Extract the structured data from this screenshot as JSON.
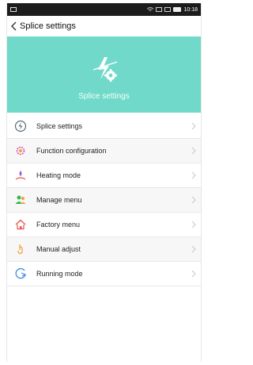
{
  "status_bar": {
    "time": "10:18"
  },
  "header": {
    "title": "Splice settings"
  },
  "banner": {
    "label": "Splice settings"
  },
  "menu": [
    {
      "label": "Splice settings",
      "icon": "splice-bolt-icon",
      "color": "#5b6b7a"
    },
    {
      "label": "Function configuration",
      "icon": "gear-config-icon",
      "color": "#d94fb1"
    },
    {
      "label": "Heating mode",
      "icon": "heating-icon",
      "color": "#9b5bd1"
    },
    {
      "label": "Manage menu",
      "icon": "manage-users-icon",
      "color": "#38b84f"
    },
    {
      "label": "Factory menu",
      "icon": "factory-home-icon",
      "color": "#e9554d"
    },
    {
      "label": "Manual adjust",
      "icon": "manual-hand-icon",
      "color": "#f2a33a"
    },
    {
      "label": "Running mode",
      "icon": "running-mode-icon",
      "color": "#3a8de0"
    }
  ],
  "colors": {
    "banner": "#71d9c9",
    "status_bar": "#1c1c1c"
  }
}
